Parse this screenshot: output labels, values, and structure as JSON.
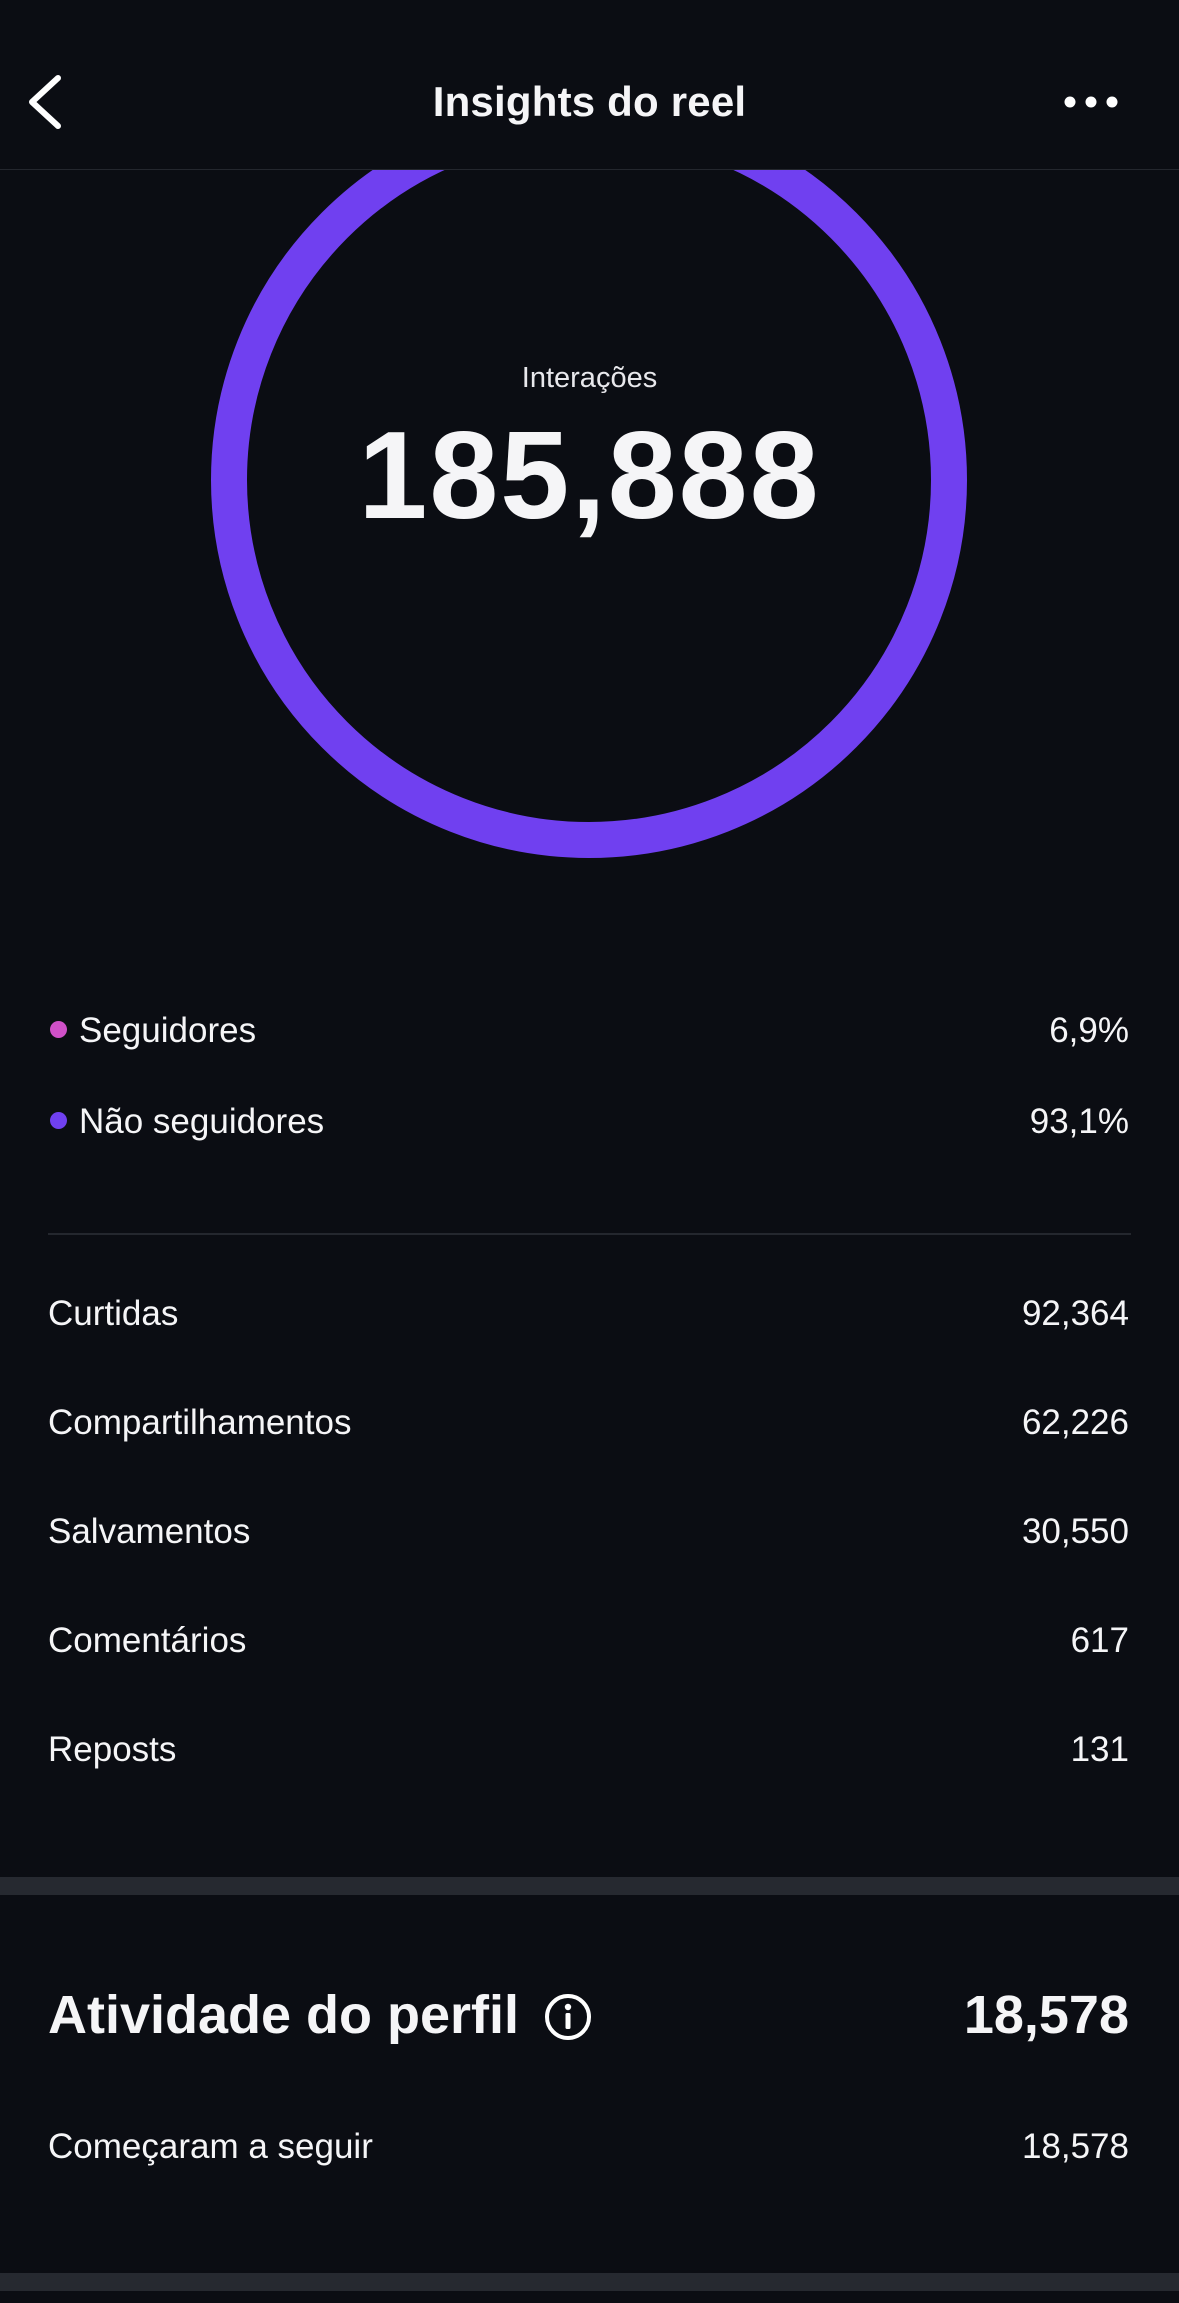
{
  "header": {
    "title": "Insights do reel",
    "back_icon": "chevron-left-icon",
    "more_icon": "more-horizontal-icon"
  },
  "interactions": {
    "label": "Interações",
    "total": "185,888",
    "ring_color": "#7040f0",
    "followers_share": 0.069
  },
  "audience": [
    {
      "label": "Seguidores",
      "value": "6,9%",
      "color": "#d050c8"
    },
    {
      "label": "Não seguidores",
      "value": "93,1%",
      "color": "#7040f0"
    }
  ],
  "metrics": [
    {
      "label": "Curtidas",
      "value": "92,364"
    },
    {
      "label": "Compartilhamentos",
      "value": "62,226"
    },
    {
      "label": "Salvamentos",
      "value": "30,550"
    },
    {
      "label": "Comentários",
      "value": "617"
    },
    {
      "label": "Reposts",
      "value": "131"
    }
  ],
  "profile_activity": {
    "title": "Atividade do perfil",
    "value": "18,578",
    "info_icon": "info-icon",
    "items": [
      {
        "label": "Começaram a seguir",
        "value": "18,578"
      }
    ]
  }
}
